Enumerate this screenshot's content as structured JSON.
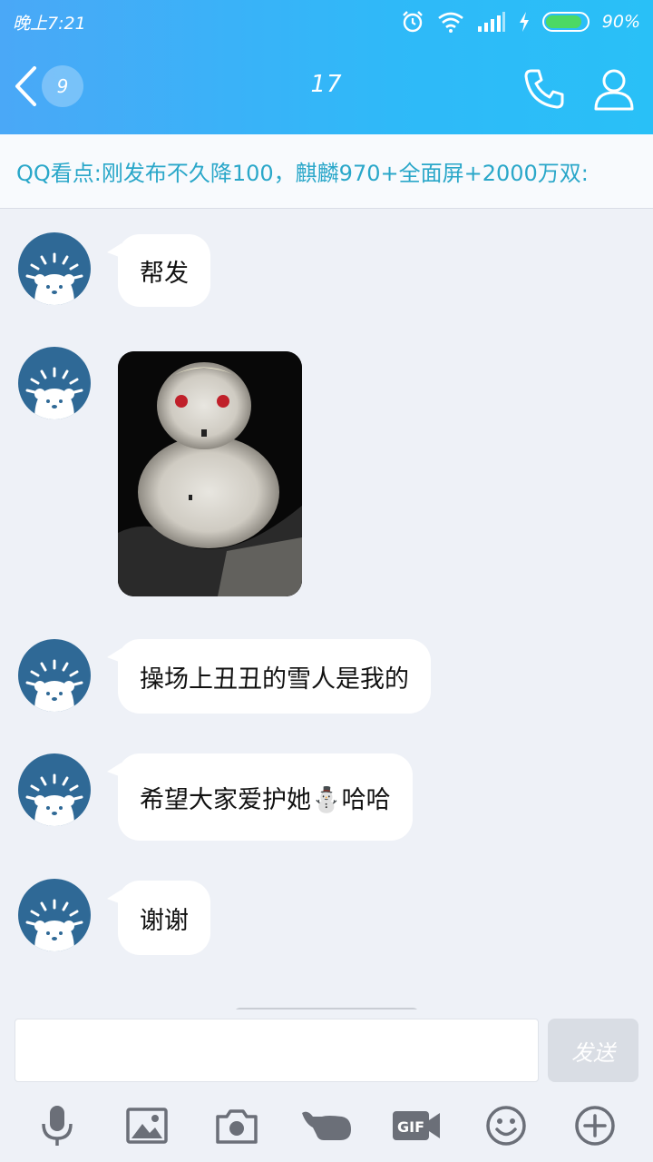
{
  "status": {
    "time": "晚上7:21",
    "battery": "90%",
    "battery_level": 0.9
  },
  "nav": {
    "unread_count": "9",
    "title": "17"
  },
  "banner": {
    "text": "QQ看点:刚发布不久降100，麒麟970+全面屏+2000万双:"
  },
  "messages": [
    {
      "type": "text",
      "text": "帮发"
    },
    {
      "type": "image",
      "icon": "snowman-photo"
    },
    {
      "type": "text",
      "text": "操场上丑丑的雪人是我的"
    },
    {
      "type": "text",
      "text": "希望大家爱护她⛄哈哈"
    },
    {
      "type": "text",
      "text": "谢谢"
    }
  ],
  "input": {
    "send_label": "发送"
  },
  "toolbar": {
    "gif_label": "GIF",
    "icons": [
      "mic-icon",
      "image-icon",
      "camera-icon",
      "poke-icon",
      "gif-icon",
      "emoji-icon",
      "plus-icon"
    ]
  },
  "colors": {
    "header_gradient_start": "#4aa8f7",
    "header_gradient_end": "#29c0f7",
    "avatar_bg": "#2f6996",
    "banner_text": "#2aa7c9",
    "background": "#eef1f7"
  }
}
